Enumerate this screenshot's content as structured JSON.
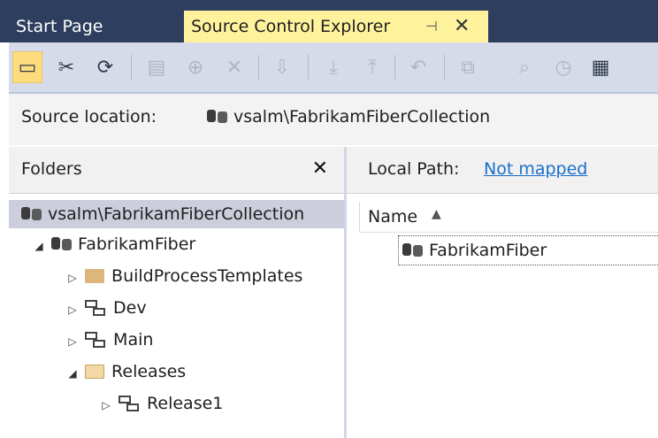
{
  "tabs": {
    "start": "Start Page",
    "active": "Source Control Explorer",
    "pin_icon": "pin-icon",
    "close_icon": "close-icon"
  },
  "toolbar": {
    "buttons": [
      {
        "icon": "toggle-folders-icon",
        "glyph": "▭",
        "state": "active"
      },
      {
        "icon": "disconnect-icon",
        "glyph": "✂",
        "state": "enabled"
      },
      {
        "icon": "refresh-icon",
        "glyph": "⟳",
        "state": "enabled"
      },
      {
        "icon": "new-folder-icon",
        "glyph": "▤",
        "state": "disabled"
      },
      {
        "icon": "add-items-icon",
        "glyph": "⊕",
        "state": "disabled"
      },
      {
        "icon": "delete-icon",
        "glyph": "✕",
        "state": "disabled"
      },
      {
        "icon": "get-latest-icon",
        "glyph": "⇩",
        "state": "disabled"
      },
      {
        "icon": "check-out-icon",
        "glyph": "⤓",
        "state": "disabled"
      },
      {
        "icon": "check-in-icon",
        "glyph": "⤒",
        "state": "disabled"
      },
      {
        "icon": "undo-icon",
        "glyph": "↶",
        "state": "disabled"
      },
      {
        "icon": "compare-icon",
        "glyph": "⧉",
        "state": "disabled"
      },
      {
        "icon": "find-icon",
        "glyph": "⌕",
        "state": "disabled"
      },
      {
        "icon": "history-icon",
        "glyph": "◷",
        "state": "disabled"
      },
      {
        "icon": "workspace-icon",
        "glyph": "▦",
        "state": "enabled"
      }
    ]
  },
  "source_location": {
    "label": "Source location:",
    "value": "vsalm\\FabrikamFiberCollection",
    "icon": "team-project-collection-icon"
  },
  "folders": {
    "title": "Folders",
    "close_icon": "close-icon",
    "tree": [
      {
        "label": "vsalm\\FabrikamFiberCollection",
        "icon": "team-project-collection-icon"
      },
      {
        "label": "FabrikamFiber",
        "icon": "team-project-icon",
        "expanded": true
      },
      {
        "label": "BuildProcessTemplates",
        "icon": "folder-icon",
        "expanded": false
      },
      {
        "label": "Dev",
        "icon": "branch-icon",
        "expanded": false
      },
      {
        "label": "Main",
        "icon": "branch-icon",
        "expanded": false
      },
      {
        "label": "Releases",
        "icon": "open-folder-icon",
        "expanded": true
      },
      {
        "label": "Release1",
        "icon": "branch-icon",
        "expanded": false
      }
    ]
  },
  "items": {
    "local_path_label": "Local Path:",
    "local_path_value": "Not mapped",
    "column_name": "Name",
    "rows": [
      {
        "label": "FabrikamFiber",
        "icon": "team-project-icon"
      }
    ]
  }
}
